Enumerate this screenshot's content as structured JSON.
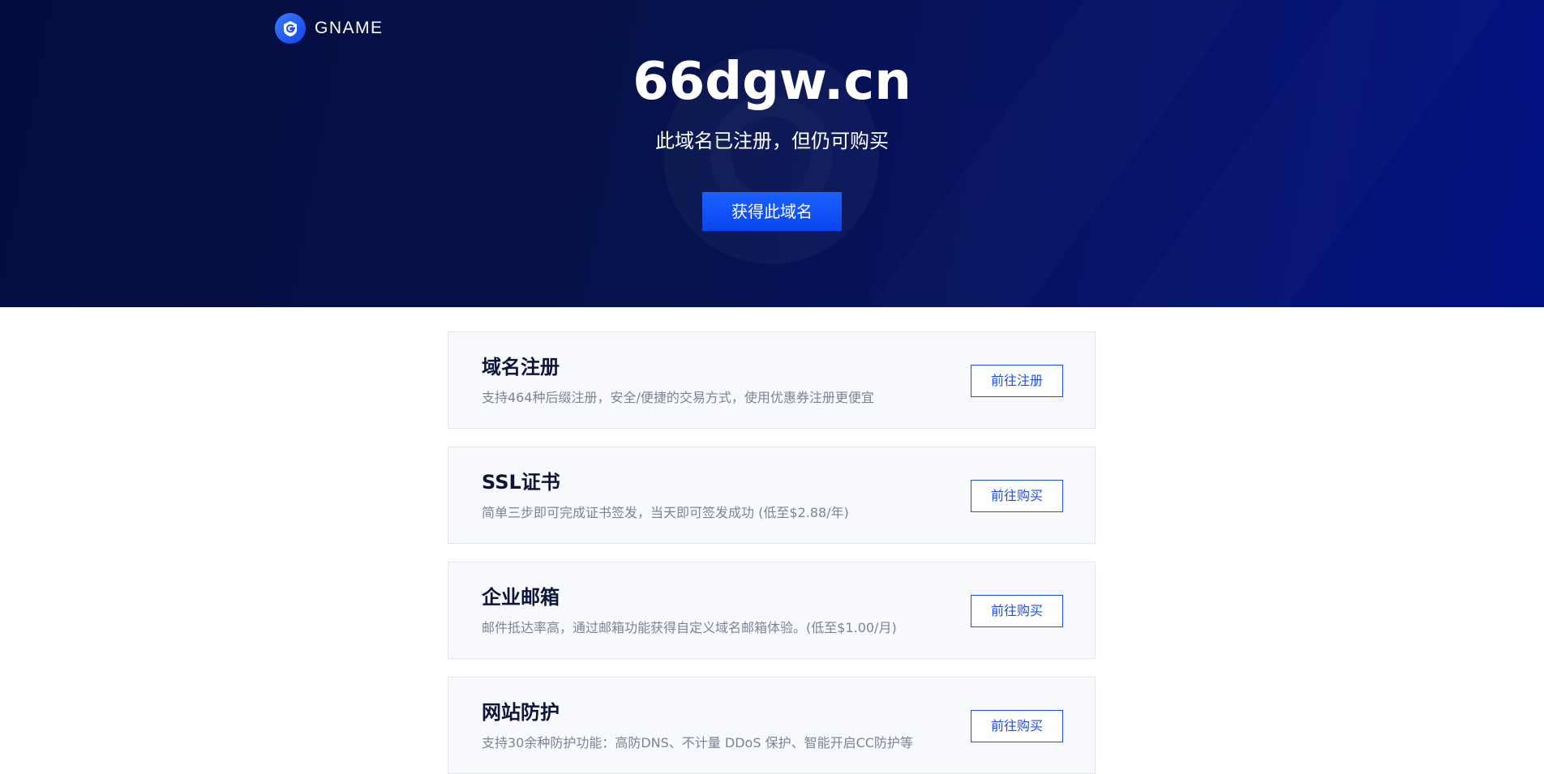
{
  "brand": {
    "logo_text": "GNAME",
    "logo_icon": "gname-g-icon"
  },
  "hero": {
    "domain": "66dgw.cn",
    "subtitle": "此域名已注册，但仍可购买",
    "cta_label": "获得此域名"
  },
  "services": [
    {
      "title": "域名注册",
      "description": "支持464种后缀注册，安全/便捷的交易方式，使用优惠券注册更便宜",
      "button_label": "前往注册"
    },
    {
      "title": "SSL证书",
      "description": "简单三步即可完成证书签发，当天即可签发成功 (低至$2.88/年)",
      "button_label": "前往购买"
    },
    {
      "title": "企业邮箱",
      "description": "邮件抵达率高，通过邮箱功能获得自定义域名邮箱体验。(低至$1.00/月)",
      "button_label": "前往购买"
    },
    {
      "title": "网站防护",
      "description": "支持30余种防护功能：高防DNS、不计量 DDoS 保护、智能开启CC防护等",
      "button_label": "前往购买"
    }
  ],
  "colors": {
    "hero_bg_dark": "#050d3f",
    "hero_bg_light": "#031283",
    "accent_blue": "#1d4fe8",
    "card_bg": "#f7f9fd"
  }
}
